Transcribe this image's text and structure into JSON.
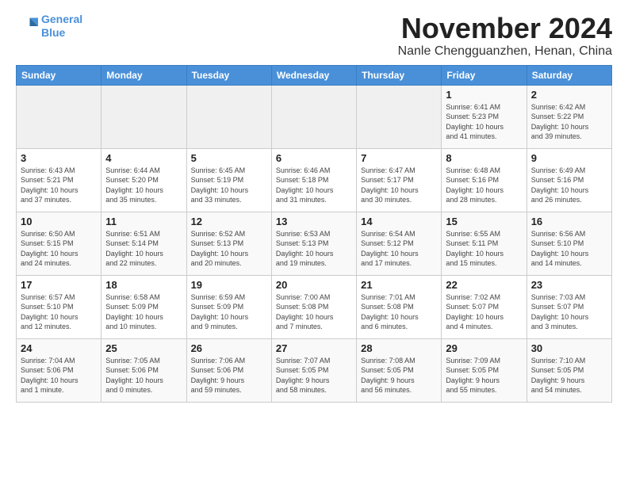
{
  "header": {
    "logo_line1": "General",
    "logo_line2": "Blue",
    "month_title": "November 2024",
    "location": "Nanle Chengguanzhen, Henan, China"
  },
  "weekdays": [
    "Sunday",
    "Monday",
    "Tuesday",
    "Wednesday",
    "Thursday",
    "Friday",
    "Saturday"
  ],
  "weeks": [
    [
      {
        "day": "",
        "info": ""
      },
      {
        "day": "",
        "info": ""
      },
      {
        "day": "",
        "info": ""
      },
      {
        "day": "",
        "info": ""
      },
      {
        "day": "",
        "info": ""
      },
      {
        "day": "1",
        "info": "Sunrise: 6:41 AM\nSunset: 5:23 PM\nDaylight: 10 hours\nand 41 minutes."
      },
      {
        "day": "2",
        "info": "Sunrise: 6:42 AM\nSunset: 5:22 PM\nDaylight: 10 hours\nand 39 minutes."
      }
    ],
    [
      {
        "day": "3",
        "info": "Sunrise: 6:43 AM\nSunset: 5:21 PM\nDaylight: 10 hours\nand 37 minutes."
      },
      {
        "day": "4",
        "info": "Sunrise: 6:44 AM\nSunset: 5:20 PM\nDaylight: 10 hours\nand 35 minutes."
      },
      {
        "day": "5",
        "info": "Sunrise: 6:45 AM\nSunset: 5:19 PM\nDaylight: 10 hours\nand 33 minutes."
      },
      {
        "day": "6",
        "info": "Sunrise: 6:46 AM\nSunset: 5:18 PM\nDaylight: 10 hours\nand 31 minutes."
      },
      {
        "day": "7",
        "info": "Sunrise: 6:47 AM\nSunset: 5:17 PM\nDaylight: 10 hours\nand 30 minutes."
      },
      {
        "day": "8",
        "info": "Sunrise: 6:48 AM\nSunset: 5:16 PM\nDaylight: 10 hours\nand 28 minutes."
      },
      {
        "day": "9",
        "info": "Sunrise: 6:49 AM\nSunset: 5:16 PM\nDaylight: 10 hours\nand 26 minutes."
      }
    ],
    [
      {
        "day": "10",
        "info": "Sunrise: 6:50 AM\nSunset: 5:15 PM\nDaylight: 10 hours\nand 24 minutes."
      },
      {
        "day": "11",
        "info": "Sunrise: 6:51 AM\nSunset: 5:14 PM\nDaylight: 10 hours\nand 22 minutes."
      },
      {
        "day": "12",
        "info": "Sunrise: 6:52 AM\nSunset: 5:13 PM\nDaylight: 10 hours\nand 20 minutes."
      },
      {
        "day": "13",
        "info": "Sunrise: 6:53 AM\nSunset: 5:13 PM\nDaylight: 10 hours\nand 19 minutes."
      },
      {
        "day": "14",
        "info": "Sunrise: 6:54 AM\nSunset: 5:12 PM\nDaylight: 10 hours\nand 17 minutes."
      },
      {
        "day": "15",
        "info": "Sunrise: 6:55 AM\nSunset: 5:11 PM\nDaylight: 10 hours\nand 15 minutes."
      },
      {
        "day": "16",
        "info": "Sunrise: 6:56 AM\nSunset: 5:10 PM\nDaylight: 10 hours\nand 14 minutes."
      }
    ],
    [
      {
        "day": "17",
        "info": "Sunrise: 6:57 AM\nSunset: 5:10 PM\nDaylight: 10 hours\nand 12 minutes."
      },
      {
        "day": "18",
        "info": "Sunrise: 6:58 AM\nSunset: 5:09 PM\nDaylight: 10 hours\nand 10 minutes."
      },
      {
        "day": "19",
        "info": "Sunrise: 6:59 AM\nSunset: 5:09 PM\nDaylight: 10 hours\nand 9 minutes."
      },
      {
        "day": "20",
        "info": "Sunrise: 7:00 AM\nSunset: 5:08 PM\nDaylight: 10 hours\nand 7 minutes."
      },
      {
        "day": "21",
        "info": "Sunrise: 7:01 AM\nSunset: 5:08 PM\nDaylight: 10 hours\nand 6 minutes."
      },
      {
        "day": "22",
        "info": "Sunrise: 7:02 AM\nSunset: 5:07 PM\nDaylight: 10 hours\nand 4 minutes."
      },
      {
        "day": "23",
        "info": "Sunrise: 7:03 AM\nSunset: 5:07 PM\nDaylight: 10 hours\nand 3 minutes."
      }
    ],
    [
      {
        "day": "24",
        "info": "Sunrise: 7:04 AM\nSunset: 5:06 PM\nDaylight: 10 hours\nand 1 minute."
      },
      {
        "day": "25",
        "info": "Sunrise: 7:05 AM\nSunset: 5:06 PM\nDaylight: 10 hours\nand 0 minutes."
      },
      {
        "day": "26",
        "info": "Sunrise: 7:06 AM\nSunset: 5:06 PM\nDaylight: 9 hours\nand 59 minutes."
      },
      {
        "day": "27",
        "info": "Sunrise: 7:07 AM\nSunset: 5:05 PM\nDaylight: 9 hours\nand 58 minutes."
      },
      {
        "day": "28",
        "info": "Sunrise: 7:08 AM\nSunset: 5:05 PM\nDaylight: 9 hours\nand 56 minutes."
      },
      {
        "day": "29",
        "info": "Sunrise: 7:09 AM\nSunset: 5:05 PM\nDaylight: 9 hours\nand 55 minutes."
      },
      {
        "day": "30",
        "info": "Sunrise: 7:10 AM\nSunset: 5:05 PM\nDaylight: 9 hours\nand 54 minutes."
      }
    ]
  ]
}
